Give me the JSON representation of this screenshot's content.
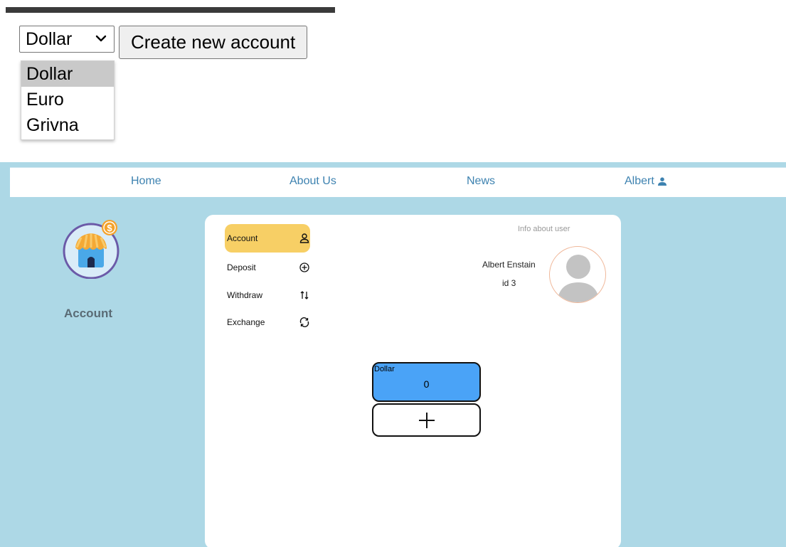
{
  "currency_select": {
    "selected": "Dollar",
    "options": [
      "Dollar",
      "Euro",
      "Grivna"
    ]
  },
  "create_button": "Create new account",
  "nav": {
    "home": "Home",
    "about": "About Us",
    "news": "News",
    "user": "Albert",
    "user_icon": "person-icon"
  },
  "sidebar": {
    "title": "Account",
    "logo_icon": "shop-coin-icon"
  },
  "menu": [
    {
      "label": "Account",
      "icon": "user-outline-icon",
      "active": true
    },
    {
      "label": "Deposit",
      "icon": "plus-circle-icon"
    },
    {
      "label": "Withdraw",
      "icon": "transfer-arrows-icon"
    },
    {
      "label": "Exchange",
      "icon": "refresh-icon"
    }
  ],
  "user_info": {
    "title": "Info about user",
    "name": "Albert Enstain",
    "id": "id 3"
  },
  "accounts": [
    {
      "currency": "Dollar",
      "balance": "0"
    }
  ],
  "colors": {
    "app_bg": "#add8e6",
    "active_menu": "#f7cf65",
    "account_card": "#4aa3f7",
    "nav_text": "#3d82b0"
  }
}
